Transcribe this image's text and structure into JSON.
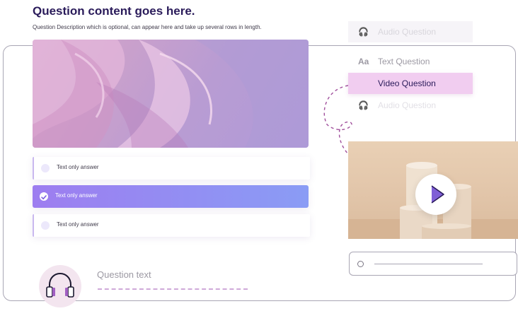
{
  "question": {
    "title": "Question content goes here.",
    "description": "Question Description which is optional, can appear here and take up several rows in length."
  },
  "answers": [
    {
      "label": "Text only answer",
      "selected": false
    },
    {
      "label": "Text only answer",
      "selected": true
    },
    {
      "label": "Text only answer",
      "selected": false
    }
  ],
  "audio_question": {
    "placeholder": "Question text",
    "icon": "headphones-icon"
  },
  "question_types": [
    {
      "label": "Audio Question",
      "icon": "headphones-icon",
      "state": "faded"
    },
    {
      "label": "Text Question",
      "icon": "text-format-icon",
      "state": "normal"
    },
    {
      "label": "Video Question",
      "icon": "",
      "state": "selected"
    },
    {
      "label": "Audio Question",
      "icon": "headphones-icon",
      "state": "faded"
    }
  ],
  "colors": {
    "title": "#2a1b5a",
    "selected_answer_start": "#9d7df0",
    "selected_answer_end": "#8a9cf5",
    "menu_selected": "#f1cdf0",
    "dashed_accent": "#a04f9c"
  }
}
